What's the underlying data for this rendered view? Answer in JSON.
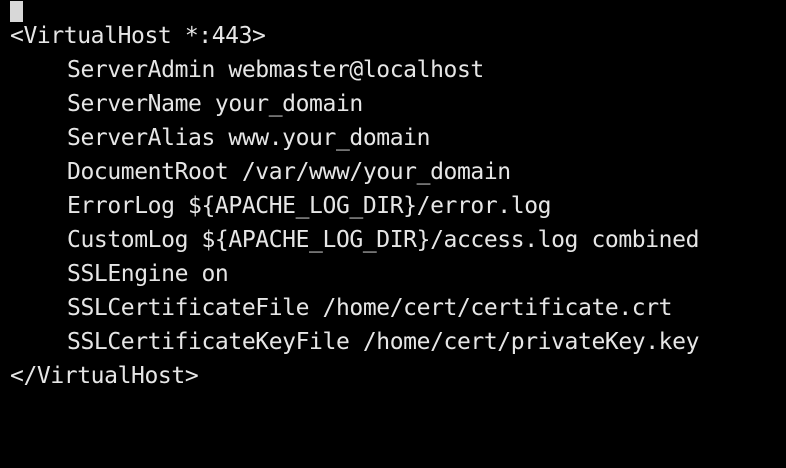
{
  "terminal": {
    "open_tag": "<VirtualHost *:443>",
    "directives": [
      "ServerAdmin webmaster@localhost",
      "ServerName your_domain",
      "ServerAlias www.your_domain",
      "DocumentRoot /var/www/your_domain",
      "ErrorLog ${APACHE_LOG_DIR}/error.log",
      "CustomLog ${APACHE_LOG_DIR}/access.log combined",
      "SSLEngine on",
      "SSLCertificateFile /home/cert/certificate.crt",
      "SSLCertificateKeyFile /home/cert/privateKey.key"
    ],
    "close_tag": "</VirtualHost>"
  },
  "colors": {
    "background": "#000000",
    "text": "#e6e6e6",
    "cursor": "#d8d8d8"
  }
}
